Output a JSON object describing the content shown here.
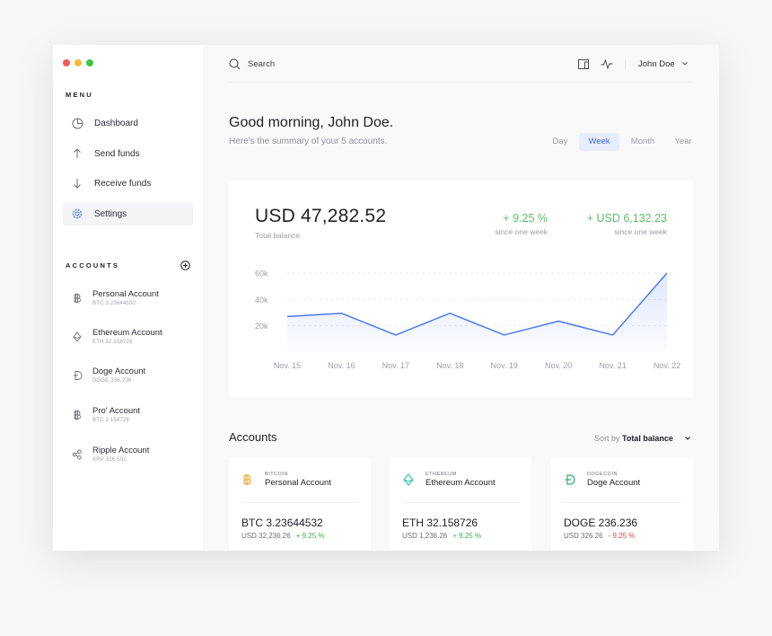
{
  "colors": {
    "accent": "#3f6fe8",
    "positive": "#5cbf6b",
    "negative": "#e0474b",
    "bitcoin": "#f0a93b",
    "ethereum": "#2ec4b0",
    "doge": "#2fae6a"
  },
  "window_controls": [
    "#f25c55",
    "#f6b93b",
    "#3bc93f"
  ],
  "sidebar": {
    "menu_title": "MENU",
    "nav": [
      {
        "label": "Dashboard",
        "icon": "pie-chart-icon"
      },
      {
        "label": "Send funds",
        "icon": "arrow-up-icon"
      },
      {
        "label": "Receive funds",
        "icon": "arrow-down-icon"
      },
      {
        "label": "Settings",
        "icon": "gear-icon",
        "active": true
      }
    ],
    "accounts_title": "ACCOUNTS",
    "accounts": [
      {
        "name": "Personal Account",
        "sub": "BTC 3.23644532",
        "icon": "bitcoin-icon"
      },
      {
        "name": "Ethereum Account",
        "sub": "ETH 32.158726",
        "icon": "ethereum-icon"
      },
      {
        "name": "Doge Account",
        "sub": "DOGE 236.236",
        "icon": "doge-icon"
      },
      {
        "name": "Pro' Account",
        "sub": "BTC 2.158726",
        "icon": "bitcoin-icon"
      },
      {
        "name": "Ripple Account",
        "sub": "XRP 326.591",
        "icon": "ripple-icon"
      }
    ]
  },
  "topbar": {
    "search_label": "Search",
    "user_name": "John Doe"
  },
  "greeting": {
    "title": "Good morning, John Doe.",
    "subtitle": "Here's the summary of your 5 accounts."
  },
  "periods": [
    {
      "label": "Day",
      "active": false
    },
    {
      "label": "Week",
      "active": true
    },
    {
      "label": "Month",
      "active": false
    },
    {
      "label": "Year",
      "active": false
    }
  ],
  "summary": {
    "balance": "USD 47,282.52",
    "balance_label": "Total balance",
    "change_pct": "+ 9.25 %",
    "change_pct_label": "since one week",
    "change_usd": "+ USD 6,132.23",
    "change_usd_label": "since one week"
  },
  "chart_data": {
    "type": "area",
    "x": [
      "Nov. 15",
      "Nov. 16",
      "Nov. 17",
      "Nov. 18",
      "Nov. 19",
      "Nov. 20",
      "Nov. 21",
      "Nov. 22"
    ],
    "series": [
      {
        "values": [
          27000,
          29500,
          13000,
          29500,
          13000,
          23500,
          13000,
          60000
        ]
      }
    ],
    "yticks": [
      "60k",
      "40k",
      "20k"
    ],
    "ytick_values": [
      60000,
      40000,
      20000
    ],
    "ylim": [
      0,
      60000
    ],
    "grid": true
  },
  "accounts_section": {
    "title": "Accounts",
    "sort_prefix": "Sort by ",
    "sort_value": "Total balance",
    "cards": [
      {
        "coin": "BITCOIN",
        "name": "Personal Account",
        "amount": "BTC 3.23644532",
        "usd": "USD 32,236.26",
        "change": "+ 9.25 %",
        "positive": true,
        "icon": "bitcoin-icon"
      },
      {
        "coin": "ETHEREUM",
        "name": "Ethereum Account",
        "amount": "ETH 32.158726",
        "usd": "USD 1,236.26",
        "change": "+ 9.25 %",
        "positive": true,
        "icon": "ethereum-icon"
      },
      {
        "coin": "DOGECOIN",
        "name": "Doge Account",
        "amount": "DOGE 236.236",
        "usd": "USD 326.26",
        "change": "- 9.25 %",
        "positive": false,
        "icon": "doge-icon"
      }
    ]
  }
}
